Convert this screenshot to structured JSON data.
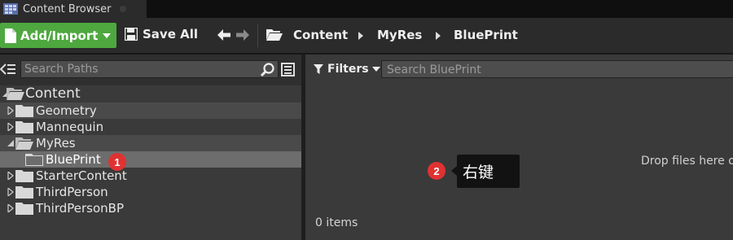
{
  "tab": {
    "title": "Content Browser"
  },
  "toolbar": {
    "add_import_label": "Add/Import",
    "save_all_label": "Save All",
    "breadcrumbs": [
      "Content",
      "MyRes",
      "BluePrint"
    ]
  },
  "left_panel": {
    "search_placeholder": "Search Paths",
    "tree": [
      {
        "label": "Content",
        "state": "expanded"
      },
      {
        "label": "Geometry",
        "state": "collapsed"
      },
      {
        "label": "Mannequin",
        "state": "collapsed"
      },
      {
        "label": "MyRes",
        "state": "expanded"
      },
      {
        "label": "BluePrint",
        "state": "selected"
      },
      {
        "label": "StarterContent",
        "state": "collapsed"
      },
      {
        "label": "ThirdPerson",
        "state": "collapsed"
      },
      {
        "label": "ThirdPersonBP",
        "state": "collapsed"
      }
    ]
  },
  "right_panel": {
    "filters_label": "Filters",
    "search_placeholder": "Search BluePrint",
    "drop_hint": "Drop files here o",
    "items_count": "0 items"
  },
  "annotations": {
    "badge_1": "1",
    "badge_2": "2",
    "tooltip_text": "右键"
  },
  "colors": {
    "add_import_bg": "#4ea83f",
    "badge_bg": "#e03232",
    "panel_bg": "#3a3a3a",
    "selected_row": "#6d6d6d"
  },
  "icons": [
    "content-browser-icon",
    "document-icon",
    "save-icon",
    "back-arrow-icon",
    "forward-arrow-icon",
    "folder-open-icon",
    "collapse-panel-icon",
    "search-icon",
    "view-options-icon",
    "folder-icon",
    "filter-icon"
  ]
}
